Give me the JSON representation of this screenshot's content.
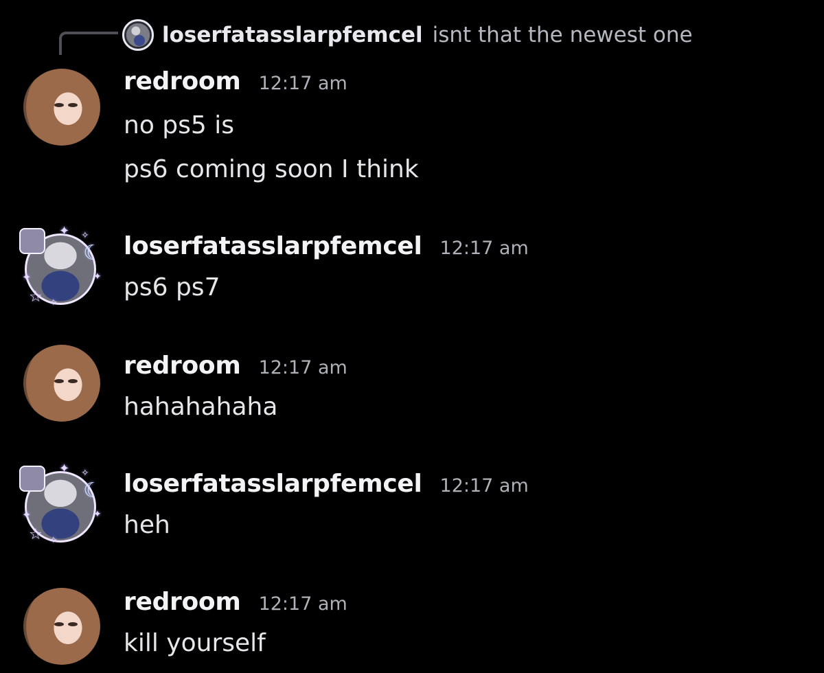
{
  "reply": {
    "author": "loserfatasslarpfemcel",
    "text": "isnt that the newest one"
  },
  "messages": [
    {
      "author": "redroom",
      "time": "12:17 am",
      "avatar": "redroom-avatar",
      "lines": [
        "no ps5 is",
        "ps6 coming soon I think"
      ]
    },
    {
      "author": "loserfatasslarpfemcel",
      "time": "12:17 am",
      "avatar": "loserfatasslarpfemcel-avatar",
      "lines": [
        "ps6 ps7"
      ]
    },
    {
      "author": "redroom",
      "time": "12:17 am",
      "avatar": "redroom-avatar",
      "lines": [
        "hahahahaha"
      ]
    },
    {
      "author": "loserfatasslarpfemcel",
      "time": "12:17 am",
      "avatar": "loserfatasslarpfemcel-avatar",
      "lines": [
        "heh"
      ]
    },
    {
      "author": "redroom",
      "time": "12:17 am",
      "avatar": "redroom-avatar",
      "lines": [
        "kill yourself"
      ]
    }
  ],
  "colors": {
    "background": "#000000",
    "author": "#f2f3f5",
    "timestamp": "#aeb1b8",
    "message_text": "#e6e7ea",
    "reply_text": "#b5b8c0",
    "reply_line": "#4e5058"
  }
}
